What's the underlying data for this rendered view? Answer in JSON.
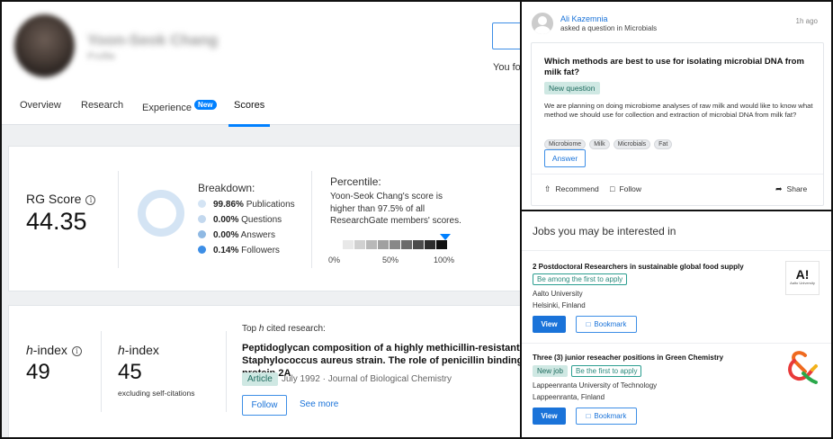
{
  "profile": {
    "name": "Yoon-Seok Chang",
    "subtext": "Profile",
    "follow_status": "You fol"
  },
  "tabs": [
    {
      "label": "Overview"
    },
    {
      "label": "Research"
    },
    {
      "label": "Experience",
      "badge": "New"
    },
    {
      "label": "Scores"
    }
  ],
  "score": {
    "label": "RG Score",
    "info_glyph": "i",
    "value": "44.35",
    "breakdown_title": "Breakdown:",
    "breakdown": [
      {
        "value": "99.86%",
        "name": "Publications",
        "color": "#d4e4f4"
      },
      {
        "value": "0.00%",
        "name": "Questions",
        "color": "#c3d8ee"
      },
      {
        "value": "0.00%",
        "name": "Answers",
        "color": "#8fb9e3"
      },
      {
        "value": "0.14%",
        "name": "Followers",
        "color": "#3d8ee6"
      }
    ],
    "percentile_title": "Percentile:",
    "percentile_desc": "Yoon-Seok Chang's score is higher than 97.5% of all ResearchGate members' scores.",
    "percentile_value": 97.5,
    "scale_ticks": [
      "0%",
      "50%",
      "100%"
    ]
  },
  "hindex": {
    "label_h": "h",
    "label_rest": "-index",
    "value": "49",
    "excl_label_h": "h",
    "excl_label_rest": "-index",
    "excl_value": "45",
    "excl_caption": "excluding self-citations",
    "top_cited_pre": "Top ",
    "top_cited_h": "h",
    "top_cited_post": " cited research:",
    "paper_title": "Peptidoglycan composition of a highly methicillin-resistant Staphylococcus aureus strain. The role of penicillin binding protein 2A",
    "article_tag": "Article",
    "paper_meta": "July 1992 · Journal of Biological Chemistry",
    "follow_label": "Follow",
    "see_more_label": "See more"
  },
  "question": {
    "asker": "Ali Kazemnia",
    "asked_text": "asked a question in Microbials",
    "time_ago": "1h ago",
    "title": "Which methods are best to use for isolating microbial DNA from milk fat?",
    "tag": "New question",
    "body": "We are planning on doing microbiome analyses of raw milk and would like to know what method we should use for collection and extraction of microbial DNA from milk fat?",
    "topics": [
      "Microbiome",
      "Milk",
      "Microbials",
      "Fat"
    ],
    "answer_label": "Answer",
    "actions": {
      "recommend": "Recommend",
      "follow": "Follow",
      "share": "Share"
    }
  },
  "jobs": {
    "title": "Jobs you may be interested in",
    "items": [
      {
        "title": "2 Postdoctoral Researchers in sustainable global food supply",
        "tags": [
          "Be among the first to apply"
        ],
        "org": "Aalto University",
        "location": "Helsinki, Finland",
        "logo_text": "A!",
        "logo_sub": "Aalto University",
        "view_label": "View",
        "bookmark_label": "Bookmark"
      },
      {
        "title": "Three (3) junior reseacher positions in Green Chemistry",
        "tags": [
          "New job",
          "Be the first to apply"
        ],
        "org": "Lappeenranta University of Technology",
        "location": "Lappeenranta, Finland",
        "view_label": "View",
        "bookmark_label": "Bookmark"
      }
    ]
  },
  "colors": {
    "accent": "#0080ff",
    "link": "#1a73d9",
    "tag_bg": "#cfe8e3",
    "tag_text": "#1d6b5e"
  },
  "icons": {
    "info": "info-icon",
    "recommend": "arrow-up-icon",
    "follow": "bookmark-icon",
    "share": "share-icon",
    "bookmark": "bookmark-icon"
  }
}
